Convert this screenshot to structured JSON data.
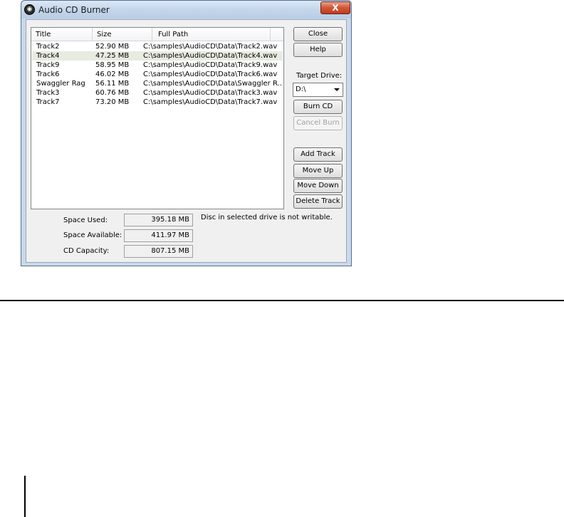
{
  "window": {
    "title": "Audio CD Burner",
    "close_glyph": "X",
    "app_icon": "cd-icon"
  },
  "list": {
    "columns": [
      "Title",
      "Size",
      "Full Path"
    ],
    "rows": [
      {
        "title": "Track2",
        "size": "52.90 MB",
        "path": "C:\\samples\\AudioCD\\Data\\Track2.wav"
      },
      {
        "title": "Track4",
        "size": "47.25 MB",
        "path": "C:\\samples\\AudioCD\\Data\\Track4.wav"
      },
      {
        "title": "Track9",
        "size": "58.95 MB",
        "path": "C:\\samples\\AudioCD\\Data\\Track9.wav"
      },
      {
        "title": "Track6",
        "size": "46.02 MB",
        "path": "C:\\samples\\AudioCD\\Data\\Track6.wav"
      },
      {
        "title": "Swaggler Rag",
        "size": "56.11 MB",
        "path": "C:\\samples\\AudioCD\\Data\\Swaggler R..."
      },
      {
        "title": "Track3",
        "size": "60.76 MB",
        "path": "C:\\samples\\AudioCD\\Data\\Track3.wav"
      },
      {
        "title": "Track7",
        "size": "73.20 MB",
        "path": "C:\\samples\\AudioCD\\Data\\Track7.wav"
      }
    ]
  },
  "buttons": {
    "close": "Close",
    "help": "Help",
    "burn": "Burn CD",
    "cancel_burn": "Cancel Burn",
    "add_track": "Add Track",
    "move_up": "Move Up",
    "move_down": "Move Down",
    "delete_track": "Delete Track"
  },
  "drive": {
    "label": "Target Drive:",
    "value": "D:\\"
  },
  "space": {
    "used_label": "Space Used:",
    "used_value": "395.18 MB",
    "available_label": "Space Available:",
    "available_value": "411.97 MB",
    "capacity_label": "CD Capacity:",
    "capacity_value": "807.15 MB"
  },
  "status": "Disc in selected drive is not writable."
}
